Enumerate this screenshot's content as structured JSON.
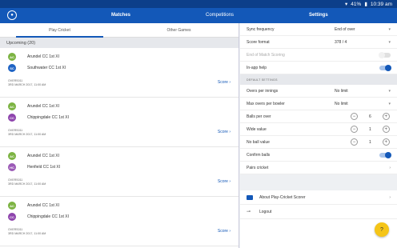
{
  "status": {
    "battery": "41%",
    "time": "10:39 am"
  },
  "header": {
    "matches_title": "Matches",
    "competitions_label": "Competitions",
    "settings_title": "Settings"
  },
  "tabs": [
    "Play Cricket",
    "Other Games"
  ],
  "upcoming_label": "Upcoming (20)",
  "matches": [
    {
      "home": {
        "abbr": "AC",
        "name": "Arundel CC 1st XI",
        "color": "#7cb342"
      },
      "away": {
        "abbr": "SC",
        "name": "Southwater CC 1st XI",
        "color": "#1e63c4"
      },
      "id": "OVERS011",
      "date": "3RD MARCH 2017, 11:00 AM",
      "score_label": "Score"
    },
    {
      "home": {
        "abbr": "AC",
        "name": "Arundel CC 1st XI",
        "color": "#7cb342"
      },
      "away": {
        "abbr": "CC",
        "name": "Chippingdale CC 1st XI",
        "color": "#8e44ad"
      },
      "id": "OVERS011",
      "date": "3RD MARCH 2017, 11:00 AM",
      "score_label": "Score"
    },
    {
      "home": {
        "abbr": "AC",
        "name": "Arundel CC 1st XI",
        "color": "#7cb342"
      },
      "away": {
        "abbr": "HC",
        "name": "Henfield CC 1st XI",
        "color": "#9b59b6"
      },
      "id": "OVERS011",
      "date": "3RD MARCH 2017, 11:00 AM",
      "score_label": "Score"
    },
    {
      "home": {
        "abbr": "AC",
        "name": "Arundel CC 1st XI",
        "color": "#7cb342"
      },
      "away": {
        "abbr": "CC",
        "name": "Chippingdale CC 1st XI",
        "color": "#8e44ad"
      },
      "id": "OVERS011",
      "date": "3RD MARCH 2017, 11:00 AM",
      "score_label": "Score"
    }
  ],
  "settings": {
    "sync_label": "Sync frequency",
    "sync_value": "End of over",
    "score_format_label": "Score format",
    "score_format_value": "378 / 4",
    "end_of_match_label": "End of Match Scoring",
    "in_app_help_label": "In-app help",
    "default_settings_header": "DEFAULT SETTINGS",
    "overs_label": "Overs per innings",
    "overs_value": "No limit",
    "max_overs_label": "Max overs per bowler",
    "max_overs_value": "No limit",
    "balls_label": "Balls per over",
    "balls_value": "6",
    "wide_label": "Wide value",
    "wide_value": "1",
    "noball_label": "No ball value",
    "noball_value": "1",
    "confirm_label": "Confirm balls",
    "pairs_label": "Pairs cricket",
    "about_label": "About Play-Cricket Scorer",
    "logout_label": "Logout"
  },
  "fab_label": "?",
  "colors": {
    "primary": "#1358b8",
    "status_bar": "#0c3f8a",
    "fab": "#f5c518"
  }
}
